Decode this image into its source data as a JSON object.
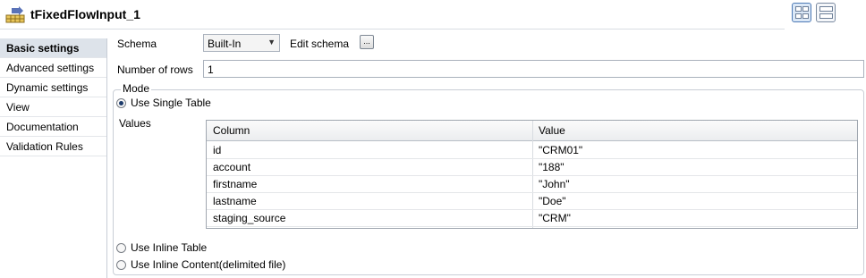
{
  "header": {
    "title": "tFixedFlowInput_1",
    "icon": "fixed-flow-input-component-icon"
  },
  "nav": {
    "items": [
      {
        "label": "Basic settings",
        "active": true
      },
      {
        "label": "Advanced settings",
        "active": false
      },
      {
        "label": "Dynamic settings",
        "active": false
      },
      {
        "label": "View",
        "active": false
      },
      {
        "label": "Documentation",
        "active": false
      },
      {
        "label": "Validation Rules",
        "active": false
      }
    ]
  },
  "form": {
    "schema_label": "Schema",
    "schema_value": "Built-In",
    "edit_schema_label": "Edit schema",
    "edit_schema_button": "...",
    "rows_label": "Number of rows",
    "rows_value": "1",
    "mode_label": "Mode",
    "options": {
      "single": "Use Single Table",
      "inline": "Use Inline Table",
      "content": "Use Inline Content(delimited file)"
    },
    "selected_option": "single",
    "values_label": "Values"
  },
  "table": {
    "columns": [
      "Column",
      "Value"
    ],
    "rows": [
      [
        "id",
        "\"CRM01\""
      ],
      [
        "account",
        "\"188\""
      ],
      [
        "firstname",
        "\"John\""
      ],
      [
        "lastname",
        "\"Doe\""
      ],
      [
        "staging_source",
        "\"CRM\""
      ]
    ]
  },
  "colors": {
    "nav_active_bg": "#dde3ea",
    "radio_selected": "#1d3b6b"
  }
}
